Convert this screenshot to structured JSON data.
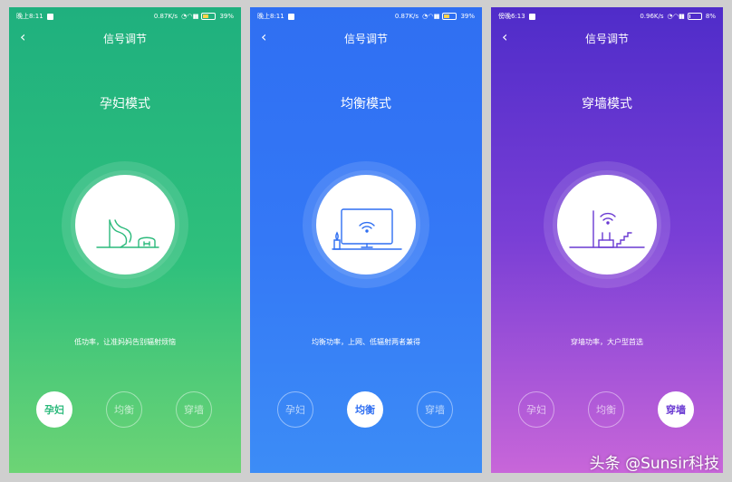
{
  "screens": [
    {
      "status": {
        "time": "晚上8:11",
        "speed": "0.87K/s",
        "battery": "39%"
      },
      "title": "信号调节",
      "mode_title": "孕妇模式",
      "description": "低功率，让准妈妈告别辐射烦恼",
      "buttons": [
        "孕妇",
        "均衡",
        "穿墙"
      ],
      "active": 0,
      "accent": "#2cba7c"
    },
    {
      "status": {
        "time": "晚上8:11",
        "speed": "0.87K/s",
        "battery": "39%"
      },
      "title": "信号调节",
      "mode_title": "均衡模式",
      "description": "均衡功率，上网、低辐射两者兼得",
      "buttons": [
        "孕妇",
        "均衡",
        "穿墙"
      ],
      "active": 1,
      "accent": "#2f6ff2"
    },
    {
      "status": {
        "time": "傍晚6:13",
        "speed": "0.96K/s",
        "battery": "8%"
      },
      "title": "信号调节",
      "mode_title": "穿墙模式",
      "description": "穿墙功率，大户型首选",
      "buttons": [
        "孕妇",
        "均衡",
        "穿墙"
      ],
      "active": 2,
      "accent": "#6a3ad2"
    }
  ],
  "watermark": "头条 @Sunsir科技"
}
